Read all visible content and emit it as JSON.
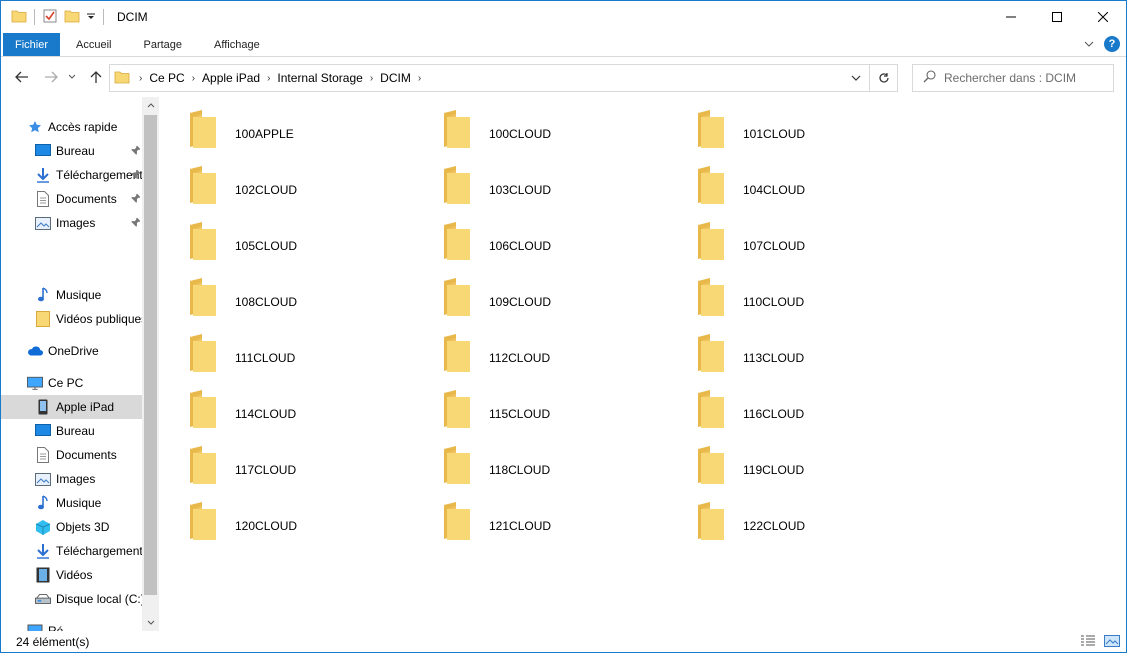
{
  "window": {
    "title": "DCIM"
  },
  "ribbon": {
    "tabs": [
      "Fichier",
      "Accueil",
      "Partage",
      "Affichage"
    ]
  },
  "address": {
    "crumbs": [
      "Ce PC",
      "Apple iPad",
      "Internal Storage",
      "DCIM"
    ]
  },
  "search": {
    "placeholder": "Rechercher dans : DCIM"
  },
  "nav": {
    "items": [
      {
        "label": "Accès rapide",
        "icon": "star-icon",
        "level": 0,
        "pinned": false
      },
      {
        "label": "Bureau",
        "icon": "desktop-icon",
        "level": 1,
        "pinned": true
      },
      {
        "label": "Téléchargements",
        "icon": "download-icon",
        "level": 1,
        "pinned": true
      },
      {
        "label": "Documents",
        "icon": "document-icon",
        "level": 1,
        "pinned": true
      },
      {
        "label": "Images",
        "icon": "image-icon",
        "level": 1,
        "pinned": true
      },
      {
        "label": "Musique",
        "icon": "music-icon",
        "level": 1,
        "pinned": false
      },
      {
        "label": "Vidéos publiques",
        "icon": "folder-icon",
        "level": 1,
        "pinned": false
      },
      {
        "label": "OneDrive",
        "icon": "cloud-icon",
        "level": 0,
        "pinned": false
      },
      {
        "label": "Ce PC",
        "icon": "pc-icon",
        "level": 0,
        "pinned": false
      },
      {
        "label": "Apple iPad",
        "icon": "ipad-icon",
        "level": 1,
        "pinned": false,
        "selected": true
      },
      {
        "label": "Bureau",
        "icon": "desktop-icon",
        "level": 1,
        "pinned": false
      },
      {
        "label": "Documents",
        "icon": "document-icon",
        "level": 1,
        "pinned": false
      },
      {
        "label": "Images",
        "icon": "image-icon",
        "level": 1,
        "pinned": false
      },
      {
        "label": "Musique",
        "icon": "music-icon",
        "level": 1,
        "pinned": false
      },
      {
        "label": "Objets 3D",
        "icon": "cube-icon",
        "level": 1,
        "pinned": false
      },
      {
        "label": "Téléchargements",
        "icon": "download-icon",
        "level": 1,
        "pinned": false
      },
      {
        "label": "Vidéos",
        "icon": "film-icon",
        "level": 1,
        "pinned": false
      },
      {
        "label": "Disque local (C:)",
        "icon": "drive-icon",
        "level": 1,
        "pinned": false
      },
      {
        "label": "Ré",
        "icon": "network-icon",
        "level": 0,
        "pinned": false
      }
    ]
  },
  "folders": [
    "100APPLE",
    "100CLOUD",
    "101CLOUD",
    "102CLOUD",
    "103CLOUD",
    "104CLOUD",
    "105CLOUD",
    "106CLOUD",
    "107CLOUD",
    "108CLOUD",
    "109CLOUD",
    "110CLOUD",
    "111CLOUD",
    "112CLOUD",
    "113CLOUD",
    "114CLOUD",
    "115CLOUD",
    "116CLOUD",
    "117CLOUD",
    "118CLOUD",
    "119CLOUD",
    "120CLOUD",
    "121CLOUD",
    "122CLOUD"
  ],
  "status": {
    "count": "24 élément(s)"
  },
  "colors": {
    "accent": "#1979ca",
    "folder": "#f8d775",
    "folder_dark": "#e8b84a",
    "selection": "#d9d9d9"
  }
}
